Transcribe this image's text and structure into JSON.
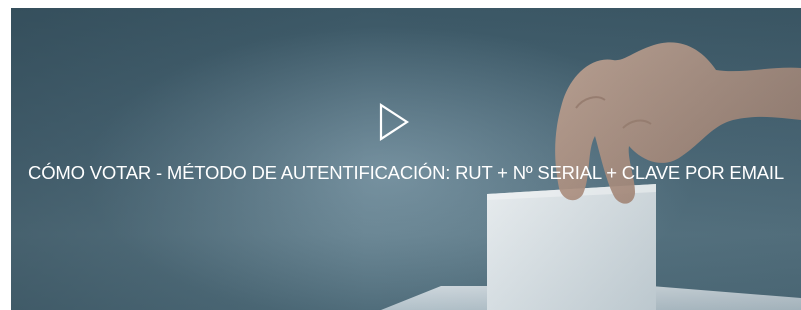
{
  "video": {
    "title": "CÓMO VOTAR - MÉTODO DE AUTENTIFICACIÓN: RUT + Nº SERIAL + CLAVE POR EMAIL",
    "play_icon": "play-icon"
  },
  "colors": {
    "background_dark": "#3c5866",
    "background_light": "#96b0be",
    "ballot": "#dfe6ea",
    "caption_text": "#ffffff"
  }
}
